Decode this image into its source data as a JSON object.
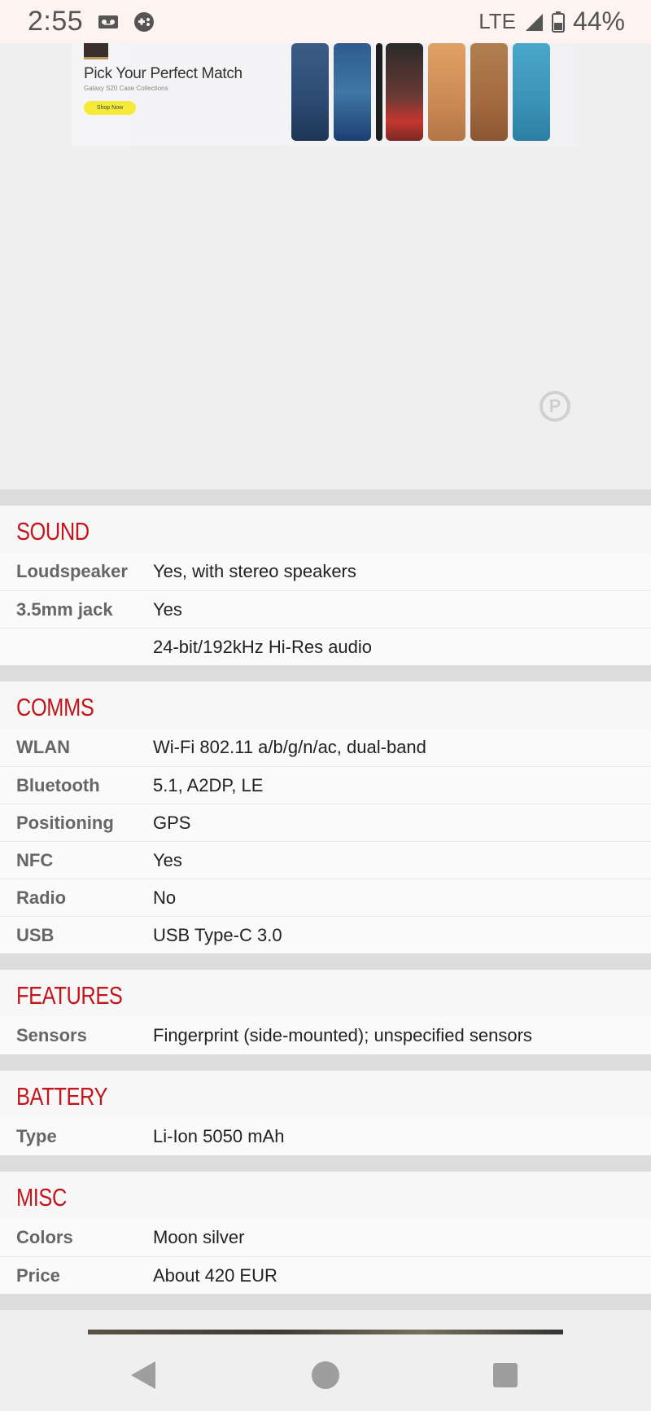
{
  "status_bar": {
    "time": "2:55",
    "network": "LTE",
    "battery": "44%"
  },
  "ad": {
    "headline": "Pick Your Perfect Match",
    "subline": "Galaxy S20 Case Collections",
    "cta": "Shop Now"
  },
  "sections": [
    {
      "title": "SOUND",
      "rows": [
        {
          "label": "Loudspeaker",
          "value": "Yes, with stereo speakers"
        },
        {
          "label": "3.5mm jack",
          "value": "Yes"
        },
        {
          "label": "",
          "value": "24-bit/192kHz Hi-Res audio"
        }
      ]
    },
    {
      "title": "COMMS",
      "rows": [
        {
          "label": "WLAN",
          "value": "Wi-Fi 802.11 a/b/g/n/ac, dual-band"
        },
        {
          "label": "Bluetooth",
          "value": "5.1, A2DP, LE"
        },
        {
          "label": "Positioning",
          "value": "GPS"
        },
        {
          "label": "NFC",
          "value": "Yes"
        },
        {
          "label": "Radio",
          "value": "No"
        },
        {
          "label": "USB",
          "value": "USB Type-C 3.0"
        }
      ]
    },
    {
      "title": "FEATURES",
      "rows": [
        {
          "label": "Sensors",
          "value": "Fingerprint (side-mounted); unspecified sensors"
        }
      ]
    },
    {
      "title": "BATTERY",
      "rows": [
        {
          "label": "Type",
          "value": "Li-Ion 5050 mAh"
        }
      ]
    },
    {
      "title": "MISC",
      "rows": [
        {
          "label": "Colors",
          "value": "Moon silver"
        },
        {
          "label": "Price",
          "value": "About 420 EUR"
        }
      ]
    }
  ],
  "colors": {
    "section_title": "#c2161b",
    "status_bar_bg": "#fdf3f1"
  }
}
